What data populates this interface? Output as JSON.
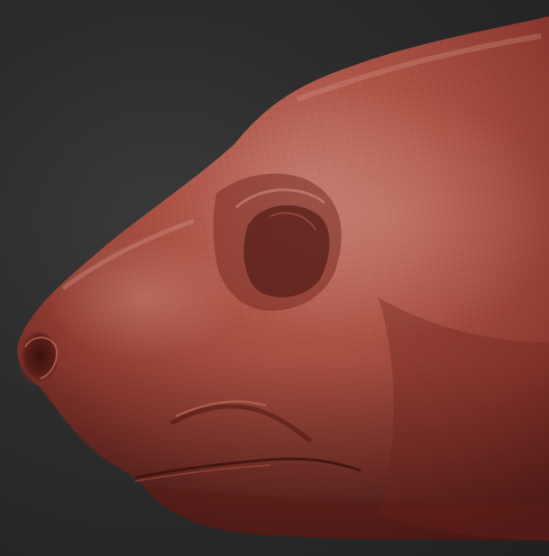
{
  "viewport": {
    "subject": "sculpted-snout-model",
    "colors": {
      "background_light": "#3a3a3a",
      "background_dark": "#1c1c1c",
      "clay_base": "#a5473c",
      "clay_highlight": "#c9776a",
      "clay_shadow": "#5e1f1a",
      "nostril_shadow": "#3e1410",
      "wire": "#7a2e27"
    }
  }
}
